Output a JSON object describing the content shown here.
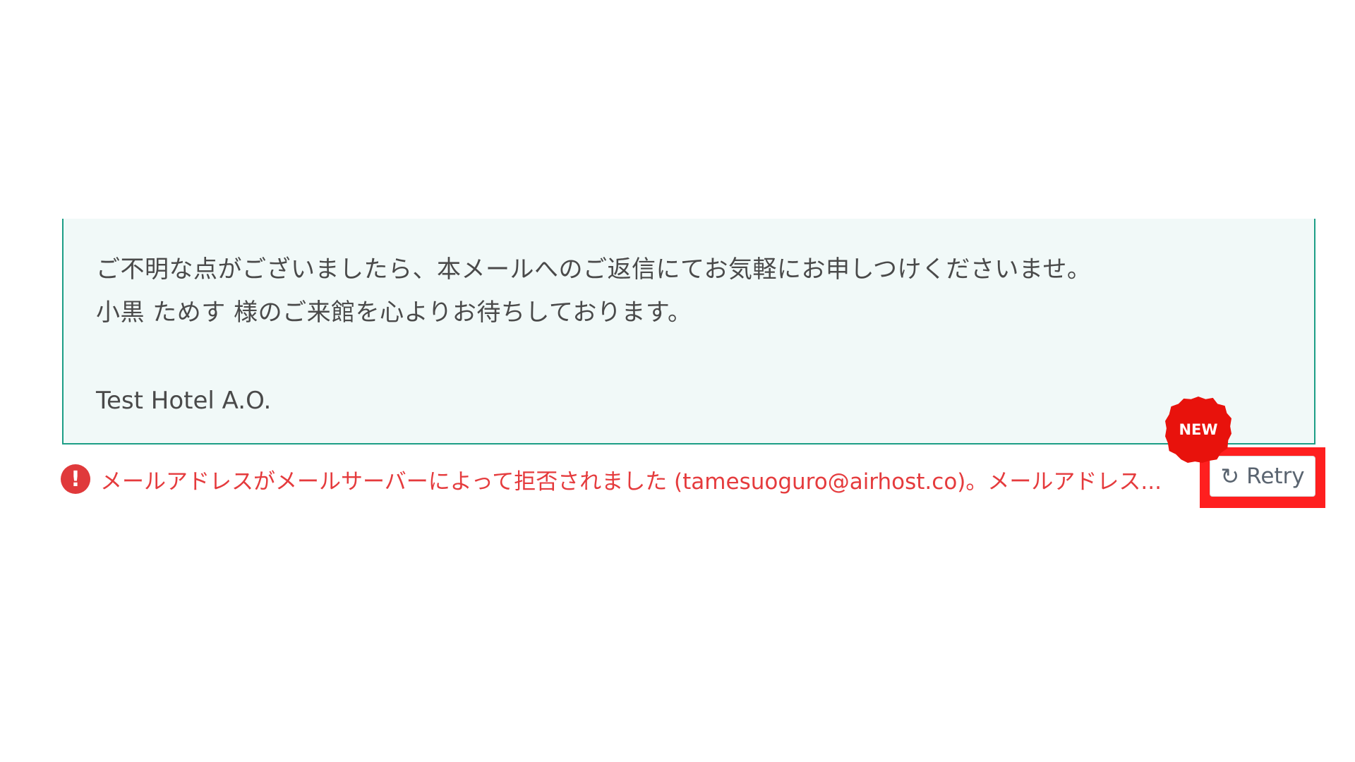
{
  "message": {
    "line1": "ご不明な点がございましたら、本メールへのご返信にてお気軽にお申しつけくださいませ。",
    "line2": "小黒 ためす 様のご来館を心よりお待ちしております。",
    "signature": "Test Hotel A.O."
  },
  "error": {
    "icon": "exclamation-circle-icon",
    "icon_glyph": "!",
    "text": "メールアドレスがメールサーバーによって拒否されました (tamesuoguro@airhost.co)。メールアドレス...",
    "color": "#e53b3d"
  },
  "retry": {
    "icon": "refresh-icon",
    "icon_glyph": "↻",
    "label": "Retry",
    "highlight_color": "#ff1f1f"
  },
  "badge": {
    "label": "NEW",
    "color": "#e8120c"
  },
  "colors": {
    "box_background": "#f1f9f8",
    "box_border": "#1c9e86"
  }
}
